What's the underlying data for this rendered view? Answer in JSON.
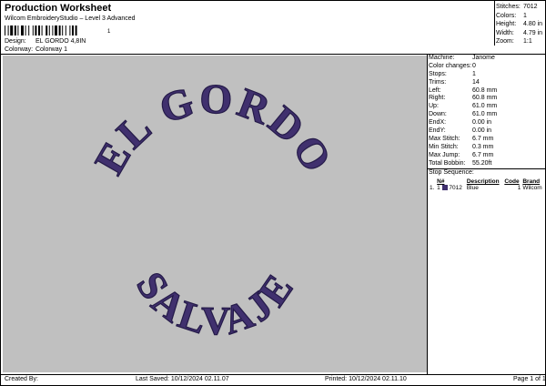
{
  "header": {
    "title": "Production Worksheet",
    "subtitle": "Wilcom EmbroideryStudio – Level 3 Advanced",
    "barcode_number": "1"
  },
  "meta": [
    {
      "label": "Design:",
      "value": "EL GORDO 4,8IN"
    },
    {
      "label": "Colorway:",
      "value": "Colorway 1"
    }
  ],
  "summary": [
    {
      "label": "Stitches:",
      "value": "7012"
    },
    {
      "label": "Colors:",
      "value": "1"
    },
    {
      "label": "Height:",
      "value": "4.80 in"
    },
    {
      "label": "Width:",
      "value": "4.79 in"
    },
    {
      "label": "Zoom:",
      "value": "1:1"
    }
  ],
  "details": [
    {
      "label": "Machine:",
      "value": "Janome"
    },
    {
      "label": "Color changes:",
      "value": "0"
    },
    {
      "label": "Stops:",
      "value": "1"
    },
    {
      "label": "Trims:",
      "value": "14"
    },
    {
      "label": "Left:",
      "value": "60.8 mm"
    },
    {
      "label": "Right:",
      "value": "60.8 mm"
    },
    {
      "label": "Up:",
      "value": "61.0 mm"
    },
    {
      "label": "Down:",
      "value": "61.0 mm"
    },
    {
      "label": "EndX:",
      "value": "0.00 in"
    },
    {
      "label": "EndY:",
      "value": "0.00 in"
    },
    {
      "label": "Max Stitch:",
      "value": "6.7 mm"
    },
    {
      "label": "Min Stitch:",
      "value": "0.3 mm"
    },
    {
      "label": "Max Jump:",
      "value": "6.7 mm"
    },
    {
      "label": "Total Bobbin:",
      "value": "55.20ft"
    }
  ],
  "stop_sequence": {
    "title": "Stop Sequence:",
    "columns": [
      "N#",
      "Description",
      "Code",
      "Brand"
    ],
    "rows": [
      {
        "stop": "1.",
        "n": "1",
        "stitches": "7012",
        "description": "Blue",
        "code": "1",
        "brand": "Wilcom"
      }
    ]
  },
  "design": {
    "top_text": "EL GORDO",
    "bottom_text": "SALVAJE",
    "thread_color": "#40306e",
    "background_color": "#c0c0c0"
  },
  "footer": {
    "created_by": "Created By:",
    "last_saved": "Last Saved: 10/12/2024 02.11.07",
    "printed": "Printed: 10/12/2024 02.11.10",
    "page": "Page 1 of 1"
  }
}
